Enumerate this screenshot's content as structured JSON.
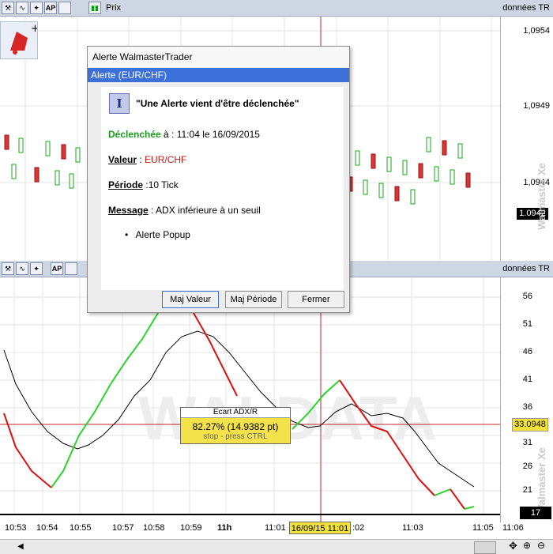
{
  "top_panel": {
    "title": "Prix",
    "source": "données TR",
    "price_labels": [
      "1,0954",
      "1,0949",
      "1,0944"
    ],
    "last_price": "1.0942",
    "watermark": "Walmaster Xe"
  },
  "bottom_panel": {
    "source": "données TR",
    "scale_labels": [
      "56",
      "51",
      "46",
      "41",
      "36",
      "31",
      "26",
      "21",
      "17"
    ],
    "ma_value": "33.0948",
    "time_labels": [
      "10:53",
      "10:54",
      "10:55",
      "10:57",
      "10:58",
      "10:59",
      "11h",
      "11:01",
      ":02",
      "11:03",
      "11:05",
      "11:06"
    ],
    "crosshair_time": "16/09/15 11:01",
    "tooltip": {
      "title": "Ecart ADX/R",
      "value": "82.27% (14.9382 pt)",
      "hint": "stop - press CTRL"
    },
    "watermark": "Walmaster Xe",
    "colors": {
      "rising": "#2ad52a",
      "falling": "#e01010",
      "adx": "#000000",
      "crosshair": "#c0262c"
    }
  },
  "dialog": {
    "window_title": "Alerte WalmasterTrader",
    "subtitle": "Alerte (EUR/CHF)",
    "headline": "\"Une Alerte vient d'être déclenchée\"",
    "triggered_label": "Déclenchée",
    "triggered_value": "à : 11:04 le 16/09/2015",
    "value_label": "Valeur",
    "value_text": "EUR/CHF",
    "period_label": "Période",
    "period_text": ":10 Tick",
    "message_label": "Message",
    "message_text": ": ADX inférieure à un seuil",
    "bullet": "Alerte Popup",
    "buttons": [
      "Maj Valeur",
      "Maj Période",
      "Fermer"
    ]
  }
}
